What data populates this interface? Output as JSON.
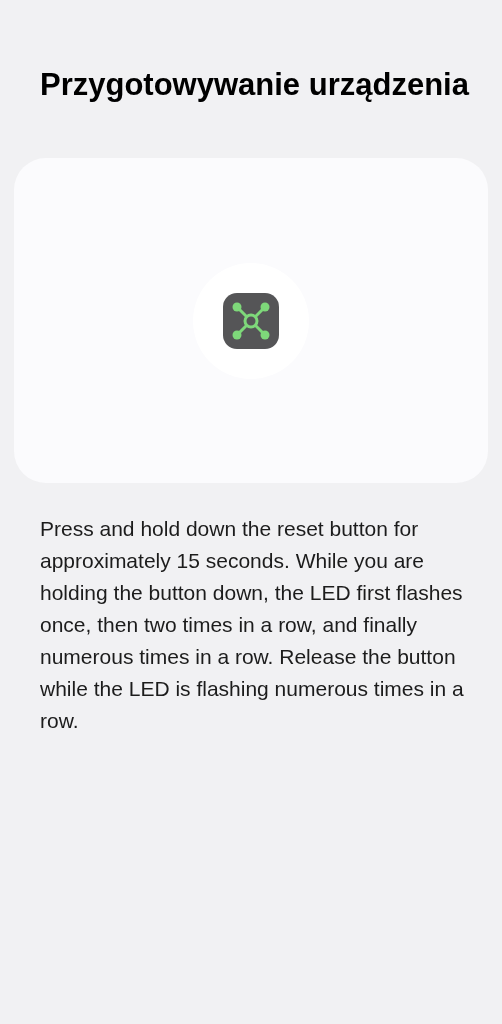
{
  "title": "Przygotowywanie urządzenia",
  "instructions": "Press and hold down the reset button for approximately 15 seconds. While you are holding the button down, the LED first flashes once, then two times in a row, and finally numerous times in a row. Release the button while the LED is flashing numerous times in a row."
}
